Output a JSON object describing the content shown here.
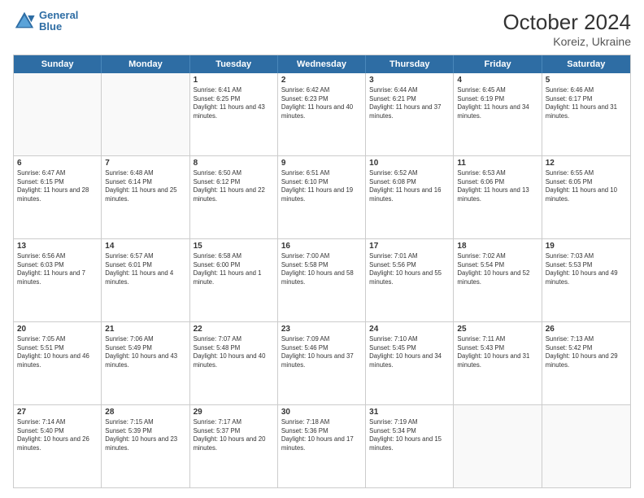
{
  "logo": {
    "line1": "General",
    "line2": "Blue"
  },
  "title": "October 2024",
  "subtitle": "Koreiz, Ukraine",
  "days": [
    "Sunday",
    "Monday",
    "Tuesday",
    "Wednesday",
    "Thursday",
    "Friday",
    "Saturday"
  ],
  "rows": [
    [
      {
        "day": "",
        "sunrise": "",
        "sunset": "",
        "daylight": ""
      },
      {
        "day": "",
        "sunrise": "",
        "sunset": "",
        "daylight": ""
      },
      {
        "day": "1",
        "sunrise": "Sunrise: 6:41 AM",
        "sunset": "Sunset: 6:25 PM",
        "daylight": "Daylight: 11 hours and 43 minutes."
      },
      {
        "day": "2",
        "sunrise": "Sunrise: 6:42 AM",
        "sunset": "Sunset: 6:23 PM",
        "daylight": "Daylight: 11 hours and 40 minutes."
      },
      {
        "day": "3",
        "sunrise": "Sunrise: 6:44 AM",
        "sunset": "Sunset: 6:21 PM",
        "daylight": "Daylight: 11 hours and 37 minutes."
      },
      {
        "day": "4",
        "sunrise": "Sunrise: 6:45 AM",
        "sunset": "Sunset: 6:19 PM",
        "daylight": "Daylight: 11 hours and 34 minutes."
      },
      {
        "day": "5",
        "sunrise": "Sunrise: 6:46 AM",
        "sunset": "Sunset: 6:17 PM",
        "daylight": "Daylight: 11 hours and 31 minutes."
      }
    ],
    [
      {
        "day": "6",
        "sunrise": "Sunrise: 6:47 AM",
        "sunset": "Sunset: 6:15 PM",
        "daylight": "Daylight: 11 hours and 28 minutes."
      },
      {
        "day": "7",
        "sunrise": "Sunrise: 6:48 AM",
        "sunset": "Sunset: 6:14 PM",
        "daylight": "Daylight: 11 hours and 25 minutes."
      },
      {
        "day": "8",
        "sunrise": "Sunrise: 6:50 AM",
        "sunset": "Sunset: 6:12 PM",
        "daylight": "Daylight: 11 hours and 22 minutes."
      },
      {
        "day": "9",
        "sunrise": "Sunrise: 6:51 AM",
        "sunset": "Sunset: 6:10 PM",
        "daylight": "Daylight: 11 hours and 19 minutes."
      },
      {
        "day": "10",
        "sunrise": "Sunrise: 6:52 AM",
        "sunset": "Sunset: 6:08 PM",
        "daylight": "Daylight: 11 hours and 16 minutes."
      },
      {
        "day": "11",
        "sunrise": "Sunrise: 6:53 AM",
        "sunset": "Sunset: 6:06 PM",
        "daylight": "Daylight: 11 hours and 13 minutes."
      },
      {
        "day": "12",
        "sunrise": "Sunrise: 6:55 AM",
        "sunset": "Sunset: 6:05 PM",
        "daylight": "Daylight: 11 hours and 10 minutes."
      }
    ],
    [
      {
        "day": "13",
        "sunrise": "Sunrise: 6:56 AM",
        "sunset": "Sunset: 6:03 PM",
        "daylight": "Daylight: 11 hours and 7 minutes."
      },
      {
        "day": "14",
        "sunrise": "Sunrise: 6:57 AM",
        "sunset": "Sunset: 6:01 PM",
        "daylight": "Daylight: 11 hours and 4 minutes."
      },
      {
        "day": "15",
        "sunrise": "Sunrise: 6:58 AM",
        "sunset": "Sunset: 6:00 PM",
        "daylight": "Daylight: 11 hours and 1 minute."
      },
      {
        "day": "16",
        "sunrise": "Sunrise: 7:00 AM",
        "sunset": "Sunset: 5:58 PM",
        "daylight": "Daylight: 10 hours and 58 minutes."
      },
      {
        "day": "17",
        "sunrise": "Sunrise: 7:01 AM",
        "sunset": "Sunset: 5:56 PM",
        "daylight": "Daylight: 10 hours and 55 minutes."
      },
      {
        "day": "18",
        "sunrise": "Sunrise: 7:02 AM",
        "sunset": "Sunset: 5:54 PM",
        "daylight": "Daylight: 10 hours and 52 minutes."
      },
      {
        "day": "19",
        "sunrise": "Sunrise: 7:03 AM",
        "sunset": "Sunset: 5:53 PM",
        "daylight": "Daylight: 10 hours and 49 minutes."
      }
    ],
    [
      {
        "day": "20",
        "sunrise": "Sunrise: 7:05 AM",
        "sunset": "Sunset: 5:51 PM",
        "daylight": "Daylight: 10 hours and 46 minutes."
      },
      {
        "day": "21",
        "sunrise": "Sunrise: 7:06 AM",
        "sunset": "Sunset: 5:49 PM",
        "daylight": "Daylight: 10 hours and 43 minutes."
      },
      {
        "day": "22",
        "sunrise": "Sunrise: 7:07 AM",
        "sunset": "Sunset: 5:48 PM",
        "daylight": "Daylight: 10 hours and 40 minutes."
      },
      {
        "day": "23",
        "sunrise": "Sunrise: 7:09 AM",
        "sunset": "Sunset: 5:46 PM",
        "daylight": "Daylight: 10 hours and 37 minutes."
      },
      {
        "day": "24",
        "sunrise": "Sunrise: 7:10 AM",
        "sunset": "Sunset: 5:45 PM",
        "daylight": "Daylight: 10 hours and 34 minutes."
      },
      {
        "day": "25",
        "sunrise": "Sunrise: 7:11 AM",
        "sunset": "Sunset: 5:43 PM",
        "daylight": "Daylight: 10 hours and 31 minutes."
      },
      {
        "day": "26",
        "sunrise": "Sunrise: 7:13 AM",
        "sunset": "Sunset: 5:42 PM",
        "daylight": "Daylight: 10 hours and 29 minutes."
      }
    ],
    [
      {
        "day": "27",
        "sunrise": "Sunrise: 7:14 AM",
        "sunset": "Sunset: 5:40 PM",
        "daylight": "Daylight: 10 hours and 26 minutes."
      },
      {
        "day": "28",
        "sunrise": "Sunrise: 7:15 AM",
        "sunset": "Sunset: 5:39 PM",
        "daylight": "Daylight: 10 hours and 23 minutes."
      },
      {
        "day": "29",
        "sunrise": "Sunrise: 7:17 AM",
        "sunset": "Sunset: 5:37 PM",
        "daylight": "Daylight: 10 hours and 20 minutes."
      },
      {
        "day": "30",
        "sunrise": "Sunrise: 7:18 AM",
        "sunset": "Sunset: 5:36 PM",
        "daylight": "Daylight: 10 hours and 17 minutes."
      },
      {
        "day": "31",
        "sunrise": "Sunrise: 7:19 AM",
        "sunset": "Sunset: 5:34 PM",
        "daylight": "Daylight: 10 hours and 15 minutes."
      },
      {
        "day": "",
        "sunrise": "",
        "sunset": "",
        "daylight": ""
      },
      {
        "day": "",
        "sunrise": "",
        "sunset": "",
        "daylight": ""
      }
    ]
  ]
}
